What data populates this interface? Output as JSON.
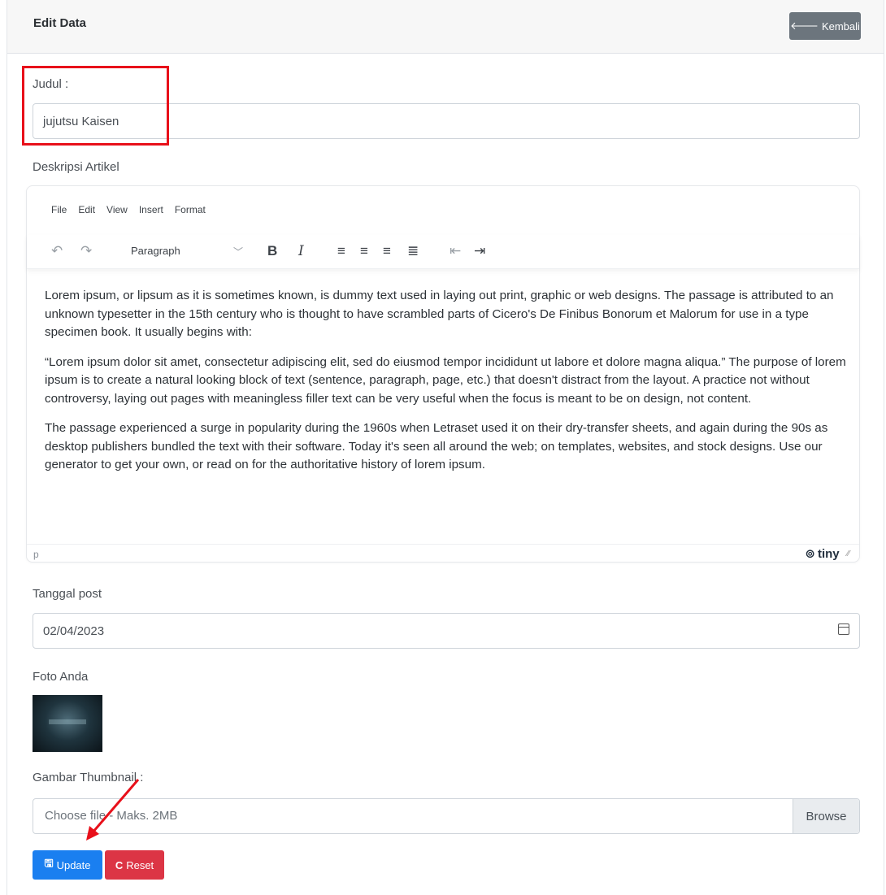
{
  "header": {
    "title": "Edit Data",
    "back_label": "Kembali",
    "back_icon": "arrow-left-icon"
  },
  "form": {
    "judul_label": "Judul :",
    "judul_value": "jujutsu Kaisen",
    "deskripsi_label": "Deskripsi Artikel",
    "tanggal_label": "Tanggal post",
    "tanggal_value": "02/04/2023",
    "foto_label": "Foto Anda",
    "thumbnail_label": "Gambar Thumbnail :",
    "file_placeholder": "Choose file - Maks. 2MB",
    "browse_label": "Browse",
    "update_label": "Update",
    "reset_label": "Reset"
  },
  "editor": {
    "menu": [
      "File",
      "Edit",
      "View",
      "Insert",
      "Format"
    ],
    "block_format": "Paragraph",
    "paragraphs": [
      "Lorem ipsum, or lipsum as it is sometimes known, is dummy text used in laying out print, graphic or web designs. The passage is attributed to an unknown typesetter in the 15th century who is thought to have scrambled parts of Cicero's De Finibus Bonorum et Malorum for use in a type specimen book. It usually begins with:",
      "“Lorem ipsum dolor sit amet, consectetur adipiscing elit, sed do eiusmod tempor incididunt ut labore et dolore magna aliqua.” The purpose of lorem ipsum is to create a natural looking block of text (sentence, paragraph, page, etc.) that doesn't distract from the layout. A practice not without controversy, laying out pages with meaningless filler text can be very useful when the focus is meant to be on design, not content.",
      "The passage experienced a surge in popularity during the 1960s when Letraset used it on their dry-transfer sheets, and again during the 90s as desktop publishers bundled the text with their software. Today it's seen all around the web; on templates, websites, and stock designs. Use our generator to get your own, or read on for the authoritative history of lorem ipsum."
    ],
    "status_path": "p",
    "brand": "tiny"
  },
  "colors": {
    "primary": "#1a7ff0",
    "danger": "#dc3545",
    "secondary": "#6c757d",
    "annotation": "#e8101a"
  }
}
